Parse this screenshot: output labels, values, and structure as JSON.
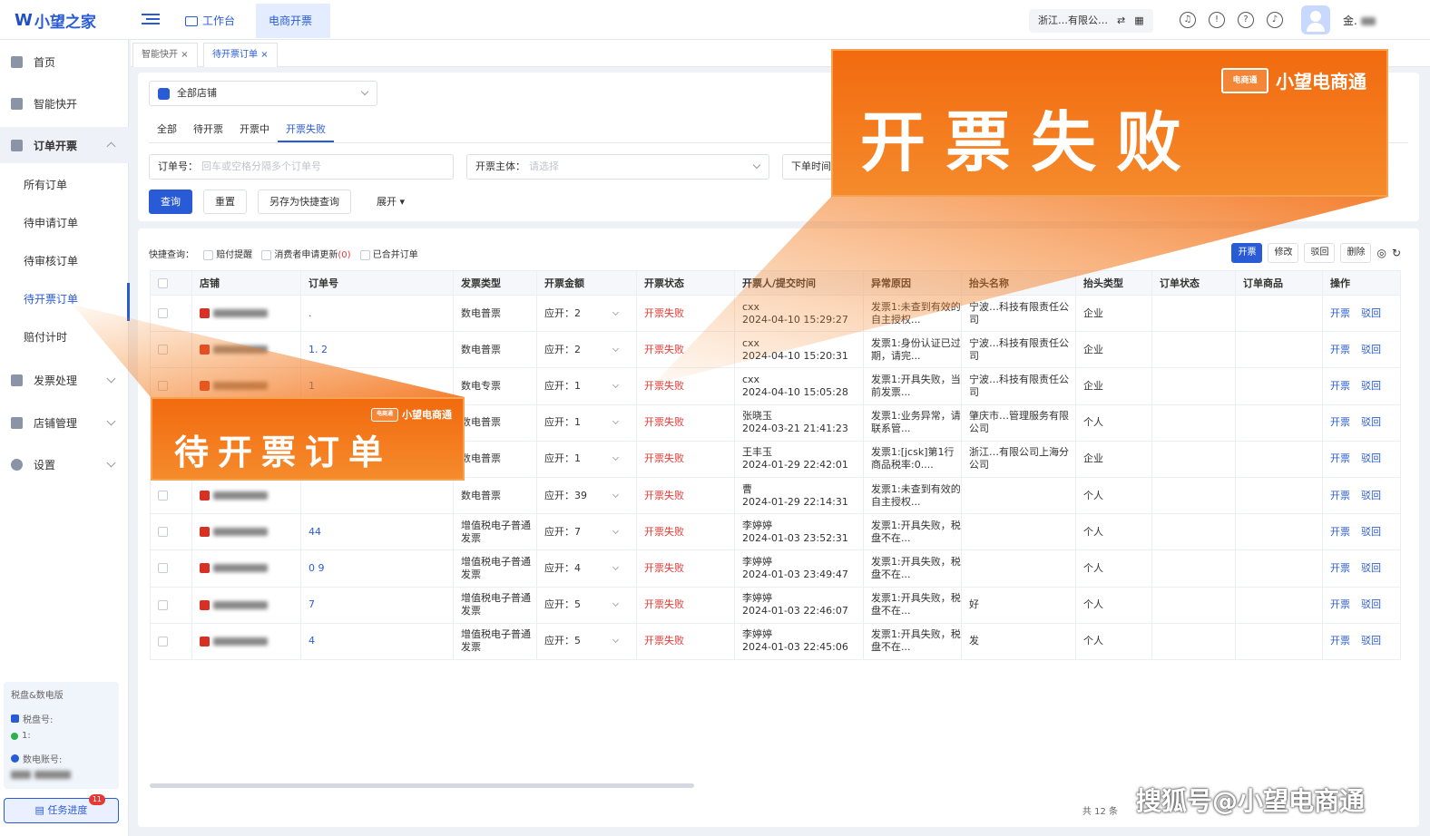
{
  "header": {
    "logo": "小望之家",
    "tabs": [
      {
        "label": "工作台"
      },
      {
        "label": "电商开票"
      }
    ],
    "company": "浙江…有限公…",
    "username": "金."
  },
  "sidebar": {
    "items": [
      {
        "label": "首页"
      },
      {
        "label": "智能快开"
      },
      {
        "label": "订单开票"
      },
      {
        "label": "发票处理"
      },
      {
        "label": "店铺管理"
      },
      {
        "label": "设置"
      }
    ],
    "subitems": [
      {
        "label": "所有订单"
      },
      {
        "label": "待申请订单"
      },
      {
        "label": "待审核订单"
      },
      {
        "label": "待开票订单"
      },
      {
        "label": "赔付计时"
      }
    ],
    "tax_box": {
      "title": "税盘&数电版",
      "disk_label": "税盘号:",
      "disk_value": "1:",
      "account_label": "数电账号:"
    },
    "task_button": "任务进度",
    "task_badge": "11"
  },
  "page_tabs": [
    {
      "label": "智能快开"
    },
    {
      "label": "待开票订单"
    }
  ],
  "filters": {
    "store_select": "全部店铺",
    "status_tabs": [
      {
        "label": "全部"
      },
      {
        "label": "待开票"
      },
      {
        "label": "开票中"
      },
      {
        "label": "开票失败"
      }
    ],
    "order_label": "订单号：",
    "order_placeholder": "回车或空格分隔多个订单号",
    "entity_label": "开票主体：",
    "entity_placeholder": "请选择",
    "time_label": "下单时间",
    "search": "查询",
    "reset": "重置",
    "save_quick": "另存为快捷查询",
    "expand": "展开"
  },
  "quick": {
    "label": "快捷查询：",
    "options": [
      "赔付提醒",
      "消费者申请更新",
      "已合并订单"
    ],
    "count": "(0)"
  },
  "actions": [
    "开票",
    "修改",
    "驳回",
    "删除"
  ],
  "table": {
    "headers": [
      "店铺",
      "订单号",
      "发票类型",
      "开票金额",
      "开票状态",
      "开票人/提交时间",
      "异常原因",
      "抬头名称",
      "抬头类型",
      "订单状态",
      "订单商品",
      "操作"
    ],
    "rows": [
      {
        "order": ".",
        "type": "数电普票",
        "amount": "应开：2",
        "status": "开票失败",
        "user": "cxx",
        "time": "2024-04-10 15:29:27",
        "reason": "发票1:未查到有效的自主授权...",
        "title": "宁波…科技有限责任公司",
        "title_type": "企业"
      },
      {
        "order": "1. 2",
        "type": "数电普票",
        "amount": "应开：2",
        "status": "开票失败",
        "user": "cxx",
        "time": "2024-04-10 15:20:31",
        "reason": "发票1:身份认证已过期，请完...",
        "title": "宁波…科技有限责任公司",
        "title_type": "企业"
      },
      {
        "order": "1",
        "type": "数电专票",
        "amount": "应开：1",
        "status": "开票失败",
        "user": "cxx",
        "time": "2024-04-10 15:05:28",
        "reason": "发票1:开具失败，当前发票...",
        "title": "宁波…科技有限责任公司",
        "title_type": "企业"
      },
      {
        "order": "",
        "type": "数电普票",
        "amount": "应开：1",
        "status": "开票失败",
        "user": "张晓玉",
        "time": "2024-03-21 21:41:23",
        "reason": "发票1:业务异常，请联系管...",
        "title": "肇庆市…管理服务有限公司",
        "title_type": "个人"
      },
      {
        "order": "",
        "type": "数电普票",
        "amount": "应开：1",
        "status": "开票失败",
        "user": "王丰玉",
        "time": "2024-01-29 22:42:01",
        "reason": "发票1:[jcsk]第1行商品税率:0....",
        "title": "浙江…有限公司上海分公司",
        "title_type": "企业"
      },
      {
        "order": "",
        "type": "数电普票",
        "amount": "应开：39",
        "status": "开票失败",
        "user": "曹",
        "time": "2024-01-29 22:14:31",
        "reason": "发票1:未查到有效的自主授权...",
        "title": "",
        "title_type": "个人"
      },
      {
        "order": "44",
        "type": "增值税电子普通发票",
        "amount": "应开：7",
        "status": "开票失败",
        "user": "李婷婷",
        "time": "2024-01-03 23:52:31",
        "reason": "发票1:开具失败，税盘不在...",
        "title": "",
        "title_type": "个人"
      },
      {
        "order": "0 9",
        "type": "增值税电子普通发票",
        "amount": "应开：4",
        "status": "开票失败",
        "user": "李婷婷",
        "time": "2024-01-03 23:49:47",
        "reason": "发票1:开具失败，税盘不在...",
        "title": "",
        "title_type": "个人"
      },
      {
        "order": "7",
        "type": "增值税电子普通发票",
        "amount": "应开：5",
        "status": "开票失败",
        "user": "李婷婷",
        "time": "2024-01-03 22:46:07",
        "reason": "发票1:开具失败，税盘不在...",
        "title": "好",
        "title_type": "个人"
      },
      {
        "order": "4",
        "type": "增值税电子普通发票",
        "amount": "应开：5",
        "status": "开票失败",
        "user": "李婷婷",
        "time": "2024-01-03 22:45:06",
        "reason": "发票1:开具失败，税盘不在...",
        "title": "发",
        "title_type": "个人"
      }
    ],
    "row_ops": [
      "开票",
      "驳回"
    ],
    "total": "共 12 条"
  },
  "overlays": {
    "big_title": "开票失败",
    "small_title": "待开票订单",
    "brand": "小望电商通",
    "brand_tag": "电商通",
    "watermark": "搜狐号@小望电商通"
  },
  "colors": {
    "accent": "#2a5bd7",
    "danger": "#e53935",
    "callout": "#f26a0e"
  }
}
